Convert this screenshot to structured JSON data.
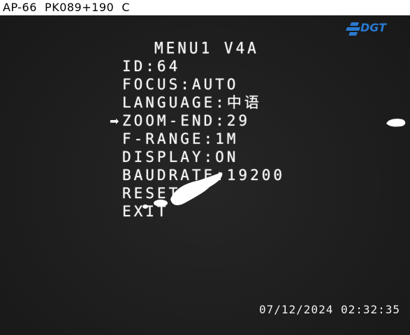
{
  "camera": {
    "label": "AP-66  PK089+190  C",
    "logo_text": "DGT",
    "timestamp": "07/12/2024 02:32:35"
  },
  "menu": {
    "title": "MENU1 V4A",
    "cursor_glyph": "➡",
    "selected_index": 3,
    "items": [
      {
        "label": "ID:64"
      },
      {
        "label": "FOCUS:AUTO"
      },
      {
        "label": "LANGUAGE:中语"
      },
      {
        "label": "ZOOM-END:29"
      },
      {
        "label": "F-RANGE:1M"
      },
      {
        "label": "DISPLAY:ON"
      },
      {
        "label": "BAUDRATE:19200"
      },
      {
        "label": "RESET"
      },
      {
        "label": "EXIT"
      }
    ]
  },
  "colors": {
    "background": "#1d1d1d",
    "osd_text": "#f4f4f4",
    "logo_blue": "#2a7ad1"
  }
}
